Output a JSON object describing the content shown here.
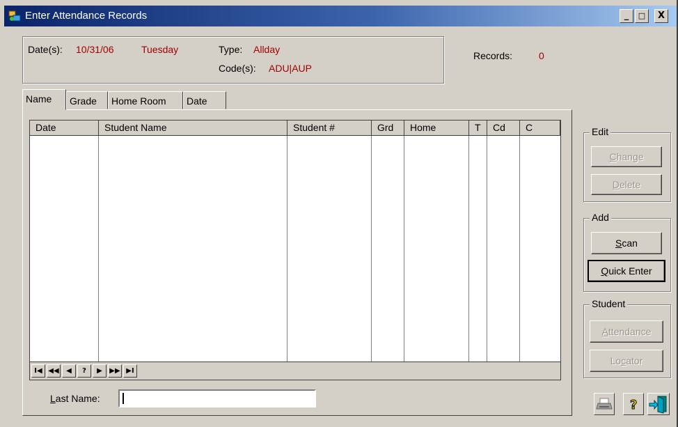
{
  "window": {
    "title": "Enter Attendance Records",
    "controls": {
      "minimize": "_",
      "maximize": "□",
      "close": "X"
    }
  },
  "info": {
    "dates_label": "Date(s):",
    "date_value": "10/31/06",
    "day_value": "Tuesday",
    "type_label": "Type:",
    "type_value": "Allday",
    "codes_label": "Code(s):",
    "codes_value": "ADU|AUP",
    "records_label": "Records:",
    "records_value": "0"
  },
  "tabs": [
    {
      "label": "Name",
      "active": true
    },
    {
      "label": "Grade"
    },
    {
      "label": "Home Room"
    },
    {
      "label": "Date"
    }
  ],
  "table": {
    "columns": [
      "Date",
      "Student Name",
      "Student #",
      "Grd",
      "Home",
      "T",
      "Cd",
      "C"
    ],
    "rows": []
  },
  "navigator": [
    "I◀",
    "◀◀",
    "◀",
    "?",
    "▶",
    "▶▶",
    "▶I"
  ],
  "search": {
    "label": "Last Name:",
    "underline": "L",
    "rest": "ast Name:",
    "value": ""
  },
  "edit_group": {
    "title": "Edit",
    "change": {
      "u": "C",
      "rest": "hange"
    },
    "delete": {
      "u": "D",
      "rest": "elete"
    }
  },
  "add_group": {
    "title": "Add",
    "scan": {
      "u": "S",
      "rest": "can"
    },
    "quick_enter": {
      "u": "Q",
      "rest": "uick Enter"
    }
  },
  "student_group": {
    "title": "Student",
    "attendance": {
      "u": "A",
      "rest": "ttendance"
    },
    "locator": {
      "pre": "Lo",
      "u": "c",
      "rest": "ator"
    }
  },
  "icons": [
    "printer-icon",
    "help-icon",
    "exit-door-icon"
  ],
  "colors": {
    "accent_red": "#a00000",
    "title_start": "#0a246a",
    "title_end": "#a6caf0",
    "face": "#d4d0c8"
  }
}
